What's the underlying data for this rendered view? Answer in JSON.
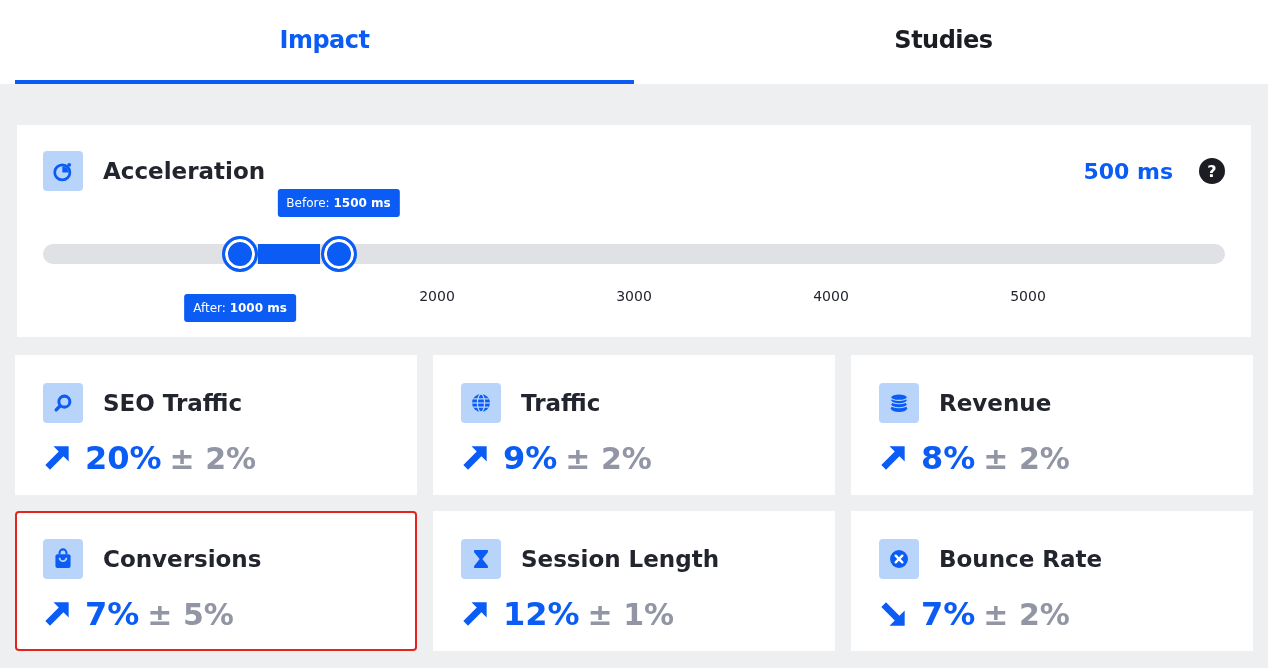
{
  "tabs": [
    {
      "label": "Impact",
      "selected": true
    },
    {
      "label": "Studies",
      "selected": false
    }
  ],
  "acceleration": {
    "title": "Acceleration",
    "value": "500 ms",
    "help": "?",
    "slider": {
      "after": {
        "label": "After:",
        "value": "1000 ms",
        "level": 0.1667
      },
      "before": {
        "label": "Before:",
        "value": "1500 ms",
        "level": 0.25
      },
      "ticks": [
        "2000",
        "3000",
        "4000",
        "5000"
      ]
    }
  },
  "metrics": [
    {
      "title": "SEO Traffic",
      "kind": "search",
      "increase": true,
      "value": "20%",
      "margin": "± 2%",
      "selected": false
    },
    {
      "title": "Traffic",
      "kind": "globe",
      "increase": true,
      "value": "9%",
      "margin": "± 2%",
      "selected": false
    },
    {
      "title": "Revenue",
      "kind": "coins",
      "increase": true,
      "value": "8%",
      "margin": "± 2%",
      "selected": false
    },
    {
      "title": "Conversions",
      "kind": "bag",
      "increase": true,
      "value": "7%",
      "margin": "± 5%",
      "selected": true
    },
    {
      "title": "Session Length",
      "kind": "hourglass",
      "increase": true,
      "value": "12%",
      "margin": "± 1%",
      "selected": false
    },
    {
      "title": "Bounce Rate",
      "kind": "cross",
      "increase": false,
      "value": "7%",
      "margin": "± 2%",
      "selected": false
    }
  ]
}
